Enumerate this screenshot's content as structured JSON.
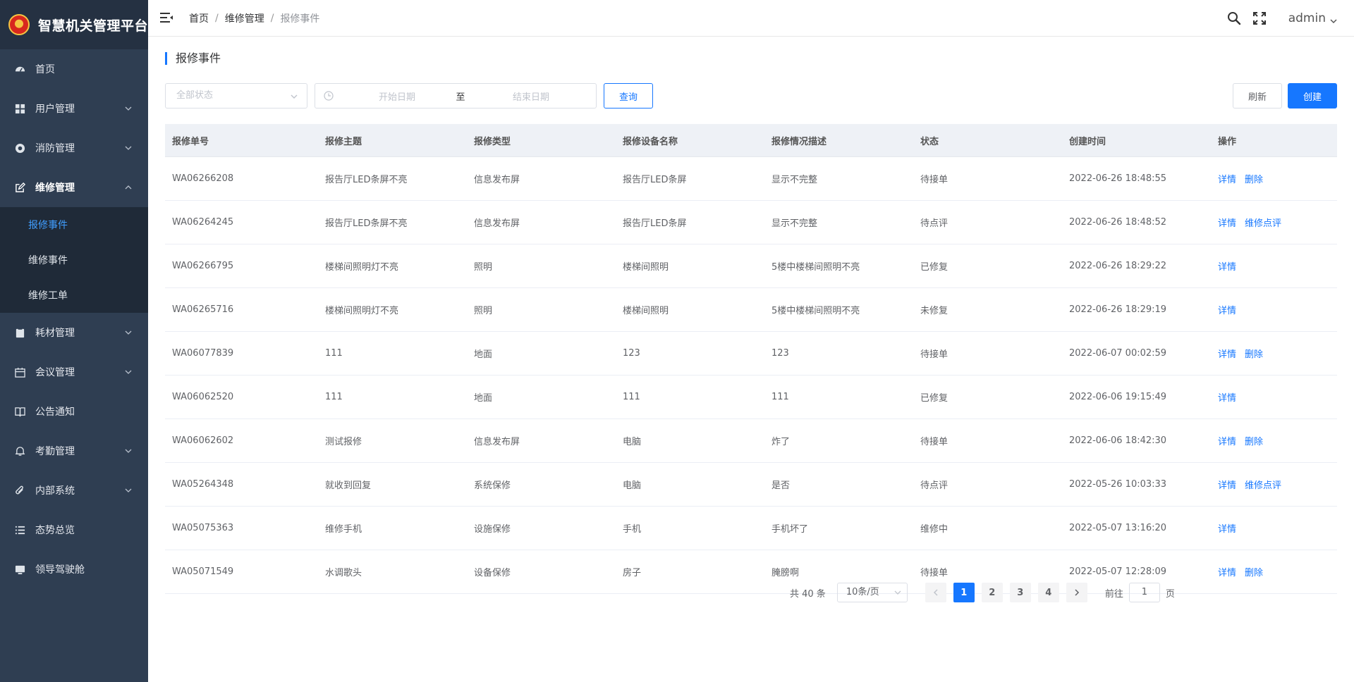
{
  "app": {
    "title": "智慧机关管理平台"
  },
  "sidebar": {
    "items": [
      {
        "label": "首页",
        "icon": "dashboard-icon"
      },
      {
        "label": "用户管理",
        "icon": "grid-icon",
        "expandable": true
      },
      {
        "label": "消防管理",
        "icon": "circle-icon",
        "expandable": true
      },
      {
        "label": "维修管理",
        "icon": "edit-icon",
        "expandable": true,
        "expanded": true,
        "children": [
          {
            "label": "报修事件",
            "active": true
          },
          {
            "label": "维修事件"
          },
          {
            "label": "维修工单"
          }
        ]
      },
      {
        "label": "耗材管理",
        "icon": "clipboard-icon",
        "expandable": true
      },
      {
        "label": "会议管理",
        "icon": "calendar-icon",
        "expandable": true
      },
      {
        "label": "公告通知",
        "icon": "book-icon"
      },
      {
        "label": "考勤管理",
        "icon": "bell-icon",
        "expandable": true
      },
      {
        "label": "内部系统",
        "icon": "paperclip-icon",
        "expandable": true
      },
      {
        "label": "态势总览",
        "icon": "list-icon"
      },
      {
        "label": "领导驾驶舱",
        "icon": "monitor-icon"
      }
    ]
  },
  "header": {
    "breadcrumb": [
      "首页",
      "维修管理",
      "报修事件"
    ],
    "separator": "/",
    "user": "admin"
  },
  "page": {
    "title": "报修事件",
    "filters": {
      "status_placeholder": "全部状态",
      "start_placeholder": "开始日期",
      "range_separator": "至",
      "end_placeholder": "结束日期",
      "query_label": "查询"
    },
    "refresh_label": "刷新",
    "create_label": "创建"
  },
  "table": {
    "columns": [
      "报修单号",
      "报修主题",
      "报修类型",
      "报修设备名称",
      "报修情况描述",
      "状态",
      "创建时间",
      "操作"
    ],
    "rows": [
      {
        "id": "WA06266208",
        "subject": "报告厅LED条屏不亮",
        "type": "信息发布屏",
        "device": "报告厅LED条屏",
        "desc": "显示不完整",
        "status": "待接单",
        "time": "2022-06-26 18:48:55",
        "actions": [
          "详情",
          "删除"
        ]
      },
      {
        "id": "WA06264245",
        "subject": "报告厅LED条屏不亮",
        "type": "信息发布屏",
        "device": "报告厅LED条屏",
        "desc": "显示不完整",
        "status": "待点评",
        "time": "2022-06-26 18:48:52",
        "actions": [
          "详情",
          "维修点评"
        ]
      },
      {
        "id": "WA06266795",
        "subject": "楼梯间照明灯不亮",
        "type": "照明",
        "device": "楼梯间照明",
        "desc": "5楼中楼梯间照明不亮",
        "status": "已修复",
        "time": "2022-06-26 18:29:22",
        "actions": [
          "详情"
        ]
      },
      {
        "id": "WA06265716",
        "subject": "楼梯间照明灯不亮",
        "type": "照明",
        "device": "楼梯间照明",
        "desc": "5楼中楼梯间照明不亮",
        "status": "未修复",
        "time": "2022-06-26 18:29:19",
        "actions": [
          "详情"
        ]
      },
      {
        "id": "WA06077839",
        "subject": "111",
        "type": "地面",
        "device": "123",
        "desc": "123",
        "status": "待接单",
        "time": "2022-06-07 00:02:59",
        "actions": [
          "详情",
          "删除"
        ]
      },
      {
        "id": "WA06062520",
        "subject": "111",
        "type": "地面",
        "device": "111",
        "desc": "111",
        "status": "已修复",
        "time": "2022-06-06 19:15:49",
        "actions": [
          "详情"
        ]
      },
      {
        "id": "WA06062602",
        "subject": "测试报修",
        "type": "信息发布屏",
        "device": "电脑",
        "desc": "炸了",
        "status": "待接单",
        "time": "2022-06-06 18:42:30",
        "actions": [
          "详情",
          "删除"
        ]
      },
      {
        "id": "WA05264348",
        "subject": "就收到回复",
        "type": "系统保修",
        "device": "电脑",
        "desc": "是否",
        "status": "待点评",
        "time": "2022-05-26 10:03:33",
        "actions": [
          "详情",
          "维修点评"
        ]
      },
      {
        "id": "WA05075363",
        "subject": "维修手机",
        "type": "设施保修",
        "device": "手机",
        "desc": "手机坏了",
        "status": "维修中",
        "time": "2022-05-07 13:16:20",
        "actions": [
          "详情"
        ]
      },
      {
        "id": "WA05071549",
        "subject": "水调歌头",
        "type": "设备保修",
        "device": "房子",
        "desc": "腌膀啊",
        "status": "待接单",
        "time": "2022-05-07 12:28:09",
        "actions": [
          "详情",
          "删除"
        ]
      }
    ]
  },
  "pagination": {
    "total_text": "共 40 条",
    "page_size": "10条/页",
    "pages": [
      "1",
      "2",
      "3",
      "4"
    ],
    "current": "1",
    "goto_label": "前往",
    "goto_value": "1",
    "page_suffix": "页"
  },
  "colors": {
    "accent": "#1677ff",
    "sidebar_bg": "#2f3e52",
    "sidebar_sub_bg": "#1f2a38",
    "active_sub": "#409eff"
  }
}
